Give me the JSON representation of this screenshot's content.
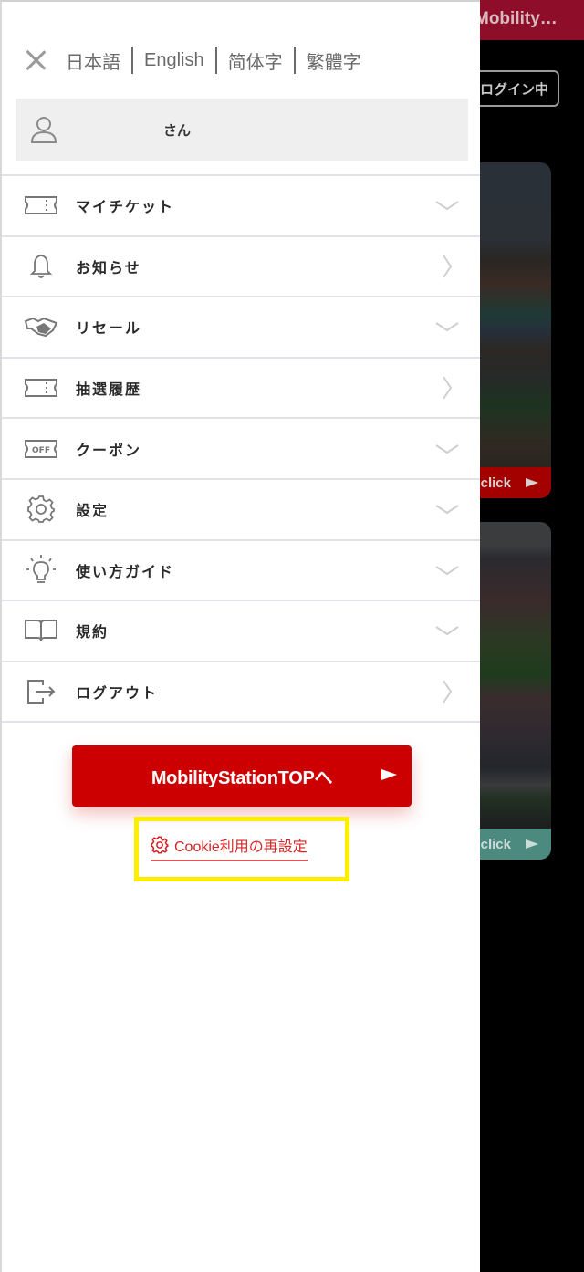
{
  "background": {
    "header_title": "Mobility…",
    "login_status": "ログイン中",
    "cards": [
      {
        "cta_label": "click",
        "cta_color": "#a30000"
      },
      {
        "cta_label": "click",
        "cta_color": "#4c8a80"
      }
    ]
  },
  "drawer": {
    "languages": [
      {
        "label": "日本語"
      },
      {
        "label": "English"
      },
      {
        "label": "简体字"
      },
      {
        "label": "繁體字"
      }
    ],
    "user": {
      "name_suffix": "さん"
    },
    "menu": [
      {
        "label": "マイチケット",
        "icon": "ticket-icon",
        "indicator": "chevron-down"
      },
      {
        "label": "お知らせ",
        "icon": "bell-icon",
        "indicator": "chevron-right"
      },
      {
        "label": "リセール",
        "icon": "handshake-icon",
        "indicator": "chevron-down"
      },
      {
        "label": "抽選履歴",
        "icon": "ticket-icon",
        "indicator": "chevron-right"
      },
      {
        "label": "クーポン",
        "icon": "coupon-off-icon",
        "indicator": "chevron-down"
      },
      {
        "label": "設定",
        "icon": "gear-icon",
        "indicator": "chevron-down"
      },
      {
        "label": "使い方ガイド",
        "icon": "lightbulb-icon",
        "indicator": "chevron-down"
      },
      {
        "label": "規約",
        "icon": "book-icon",
        "indicator": "chevron-down"
      },
      {
        "label": "ログアウト",
        "icon": "logout-icon",
        "indicator": "chevron-right"
      }
    ],
    "top_button_label": "MobilityStationTOPへ",
    "cookie_link_label": "Cookie利用の再設定",
    "colors": {
      "accent": "#cc0000",
      "link": "#d42626",
      "highlight": "#ffee00"
    }
  }
}
